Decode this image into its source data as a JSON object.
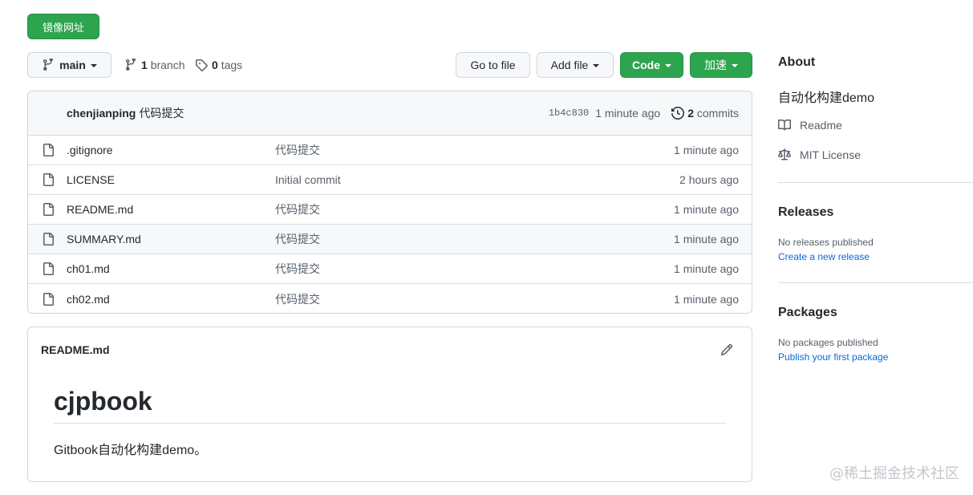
{
  "toolbar": {
    "mirror_label": "镜像网址",
    "branch_name": "main",
    "branch_count": "1",
    "branch_word": "branch",
    "tag_count": "0",
    "tag_word": "tags",
    "goto_file_label": "Go to file",
    "add_file_label": "Add file",
    "code_label": "Code",
    "speed_label": "加速"
  },
  "commit": {
    "author": "chenjianping",
    "message": "代码提交",
    "sha": "1b4c830",
    "time": "1 minute ago",
    "count": "2",
    "count_word": "commits"
  },
  "files": [
    {
      "name": ".gitignore",
      "message": "代码提交",
      "age": "1 minute ago"
    },
    {
      "name": "LICENSE",
      "message": "Initial commit",
      "age": "2 hours ago"
    },
    {
      "name": "README.md",
      "message": "代码提交",
      "age": "1 minute ago"
    },
    {
      "name": "SUMMARY.md",
      "message": "代码提交",
      "age": "1 minute ago"
    },
    {
      "name": "ch01.md",
      "message": "代码提交",
      "age": "1 minute ago"
    },
    {
      "name": "ch02.md",
      "message": "代码提交",
      "age": "1 minute ago"
    }
  ],
  "readme": {
    "file_title": "README.md",
    "heading": "cjpbook",
    "paragraph": "Gitbook自动化构建demo。"
  },
  "sidebar": {
    "about_heading": "About",
    "description": "自动化构建demo",
    "readme_label": "Readme",
    "license_label": "MIT License",
    "releases_heading": "Releases",
    "no_releases": "No releases published",
    "create_release": "Create a new release",
    "packages_heading": "Packages",
    "no_packages": "No packages published",
    "publish_package": "Publish your first package"
  },
  "watermark": "@稀土掘金技术社区",
  "colors": {
    "primary_green": "#2da44e",
    "link_blue": "#0969da",
    "muted_text": "#57606a",
    "border": "#d0d7de"
  },
  "icons": [
    "git-branch-icon",
    "tag-icon",
    "file-icon",
    "history-icon",
    "pencil-icon",
    "book-icon",
    "law-icon"
  ]
}
